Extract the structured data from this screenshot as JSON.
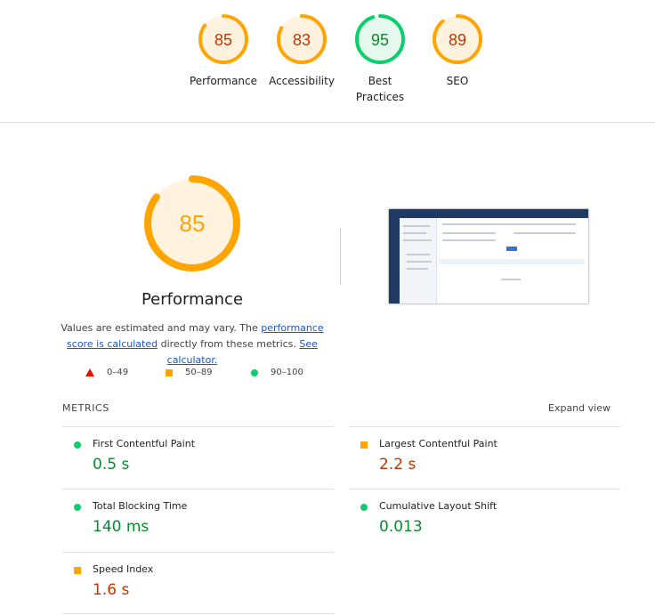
{
  "colors": {
    "pass": "#0cce6b",
    "average": "#ffa400",
    "fail": "#eb0f00",
    "pass_text": "#0a8a2e",
    "average_text": "#c33300",
    "average_fill": "#fff3e0",
    "pass_fill": "#e6f9ee"
  },
  "categories": [
    {
      "label": "Performance",
      "score": 85,
      "rating": "average"
    },
    {
      "label": "Accessibility",
      "score": 83,
      "rating": "average"
    },
    {
      "label": "Best Practices",
      "score": 95,
      "rating": "pass"
    },
    {
      "label": "SEO",
      "score": 89,
      "rating": "average"
    }
  ],
  "performance": {
    "score": 85,
    "title": "Performance",
    "desc_1": "Values are estimated and may vary. The ",
    "link_score": "performance score is calculated",
    "desc_2": " directly from these metrics. ",
    "link_calc": "See calculator."
  },
  "legend": [
    {
      "range": "0–49",
      "icon": "triangle-icon"
    },
    {
      "range": "50–89",
      "icon": "square-icon"
    },
    {
      "range": "90–100",
      "icon": "circle-icon"
    }
  ],
  "metrics_header": "METRICS",
  "expand_label": "Expand view",
  "metrics": [
    {
      "name": "First Contentful Paint",
      "value": "0.5 s",
      "rating": "pass"
    },
    {
      "name": "Largest Contentful Paint",
      "value": "2.2 s",
      "rating": "average"
    },
    {
      "name": "Total Blocking Time",
      "value": "140 ms",
      "rating": "pass"
    },
    {
      "name": "Cumulative Layout Shift",
      "value": "0.013",
      "rating": "pass"
    },
    {
      "name": "Speed Index",
      "value": "1.6 s",
      "rating": "average"
    }
  ]
}
